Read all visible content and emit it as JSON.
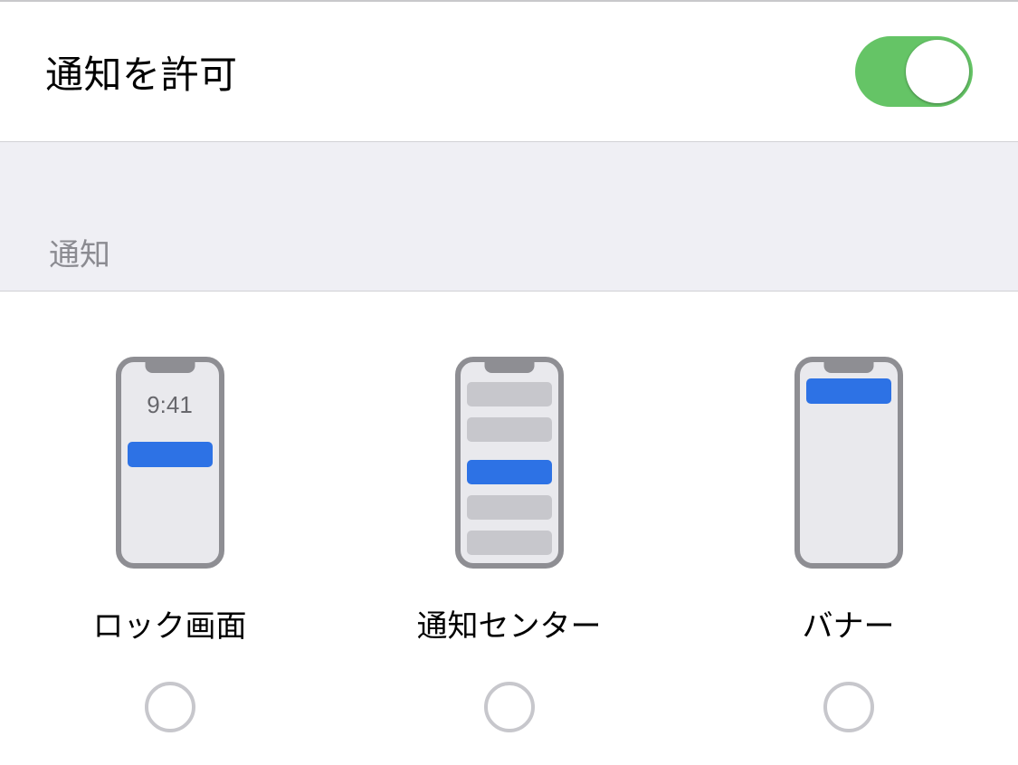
{
  "allow_row": {
    "label": "通知を許可",
    "toggle_on": true
  },
  "section_header": "通知",
  "lock_time": "9:41",
  "options": [
    {
      "label": "ロック画面"
    },
    {
      "label": "通知センター"
    },
    {
      "label": "バナー"
    }
  ],
  "colors": {
    "toggle_on": "#65c466",
    "accent_blue": "#2d72e5"
  }
}
